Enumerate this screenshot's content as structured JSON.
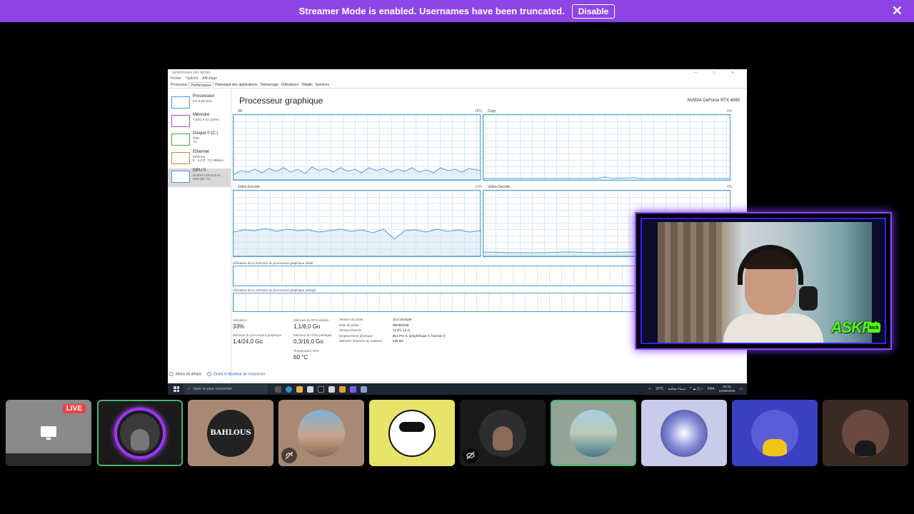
{
  "banner": {
    "message": "Streamer Mode is enabled. Usernames have been truncated.",
    "disable_label": "Disable",
    "close_glyph": "✕",
    "color": "#8d45e6"
  },
  "taskmgr": {
    "window_title": "Gestionnaire des tâches",
    "menu": [
      "Fichier",
      "Options",
      "Affichage"
    ],
    "tabs": [
      "Processus",
      "Performance",
      "Historique des applications",
      "Démarrage",
      "Utilisateurs",
      "Détails",
      "Services"
    ],
    "active_tab": "Performance",
    "sidebar": [
      {
        "name": "Processeur",
        "sub1": "6% 3,95 GHz",
        "sub2": "",
        "sub3": ""
      },
      {
        "name": "Mémoire",
        "sub1": "7,0/31,9 Go (22%)",
        "sub2": "",
        "sub3": ""
      },
      {
        "name": "Disque 0 (C:)",
        "sub1": "SSD",
        "sub2": "1%",
        "sub3": ""
      },
      {
        "name": "Ethernet",
        "sub1": "Ethernet",
        "sub2": "E : 4,2 R : 0,2 Mbits/s",
        "sub3": ""
      },
      {
        "name": "GPU 0",
        "sub1": "NVIDIA GeForce R...",
        "sub2": "33% (60 °C)",
        "sub3": ""
      }
    ],
    "heading": "Processeur graphique",
    "gpu_name": "NVIDIA GeForce RTX 4060",
    "graphs": [
      {
        "label": "3D",
        "pct": "18%"
      },
      {
        "label": "Copy",
        "pct": "0%"
      },
      {
        "label": "Video Encode",
        "pct": "13%"
      },
      {
        "label": "Video Decode",
        "pct": "4%"
      }
    ],
    "mem_dedicated_label": "Utilisation de la mémoire du processeur graphique dédié",
    "mem_shared_label": "Utilisation de la mémoire du processeur graphique partagé",
    "stats": {
      "utilisation_label": "Utilisation",
      "utilisation_value": "33%",
      "gpu_mem_label": "Mémoire du processeur graphique",
      "gpu_mem_value": "1,4/24,0 Go",
      "dedicated_label": "Mémoire du GPU dédiée",
      "dedicated_value": "1,1/8,0 Go",
      "shared_label": "Mémoire du GPU partagée",
      "shared_value": "0,3/16,0 Go",
      "temp_label": "Température GPU",
      "temp_value": "60 °C"
    },
    "props_labels": [
      "Version du pilote :",
      "Date du pilote :",
      "Version DirectX :",
      "Emplacement physique :",
      "Mémoire réservée du matériel :"
    ],
    "props_values": [
      "32.0.15.8129",
      "05/08/2025",
      "12 (FL 12.1)",
      "Bus PCI 6, périphérique 0, fonction 0",
      "235 Mo"
    ],
    "footer_less": "Moins de détails",
    "footer_monitor": "Ouvrir le Moniteur de ressources"
  },
  "taskbar": {
    "search_placeholder": "Taper ici pour rechercher",
    "weather": "23°C",
    "weather_text": "سماء صافية",
    "lang": "FRA",
    "time": "00:02",
    "date": "22/09/2025"
  },
  "webcam": {
    "overlay_text": "ASKRI",
    "badge_text": "kick"
  },
  "participants": [
    {
      "kind": "screen",
      "live_label": "LIVE"
    },
    {
      "kind": "avatar",
      "bg": "#1a1a1a"
    },
    {
      "kind": "avatar",
      "bg": "#a88a74",
      "avatar_text": "BAHLOUS"
    },
    {
      "kind": "avatar",
      "bg": "#a88a74",
      "muted": true
    },
    {
      "kind": "avatar",
      "bg": "#e8e46a"
    },
    {
      "kind": "avatar",
      "bg": "#1a1a1a",
      "muted": true
    },
    {
      "kind": "avatar",
      "bg": "#93a497"
    },
    {
      "kind": "avatar",
      "bg": "#c9cbea"
    },
    {
      "kind": "avatar",
      "bg": "#3b3fc2"
    },
    {
      "kind": "avatar",
      "bg": "#3a2a26"
    }
  ]
}
